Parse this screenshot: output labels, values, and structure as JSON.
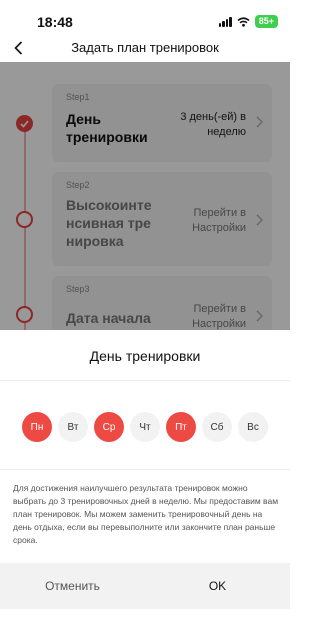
{
  "status_bar": {
    "time": "18:48",
    "battery": "85+"
  },
  "header": {
    "title": "Задать план тренировок"
  },
  "steps": [
    {
      "num": "Step1",
      "title": "День тренировки",
      "value": "3 день(-ей) в неделю",
      "status": "done"
    },
    {
      "num": "Step2",
      "title": "Высокоинтенсивная тренировка",
      "value": "Перейти в Настройки",
      "status": "pending"
    },
    {
      "num": "Step3",
      "title": "Дата начала",
      "value": "Перейти в Настройки",
      "status": "pending"
    }
  ],
  "sheet": {
    "title": "День тренировки",
    "days": [
      {
        "label": "Пн",
        "selected": true
      },
      {
        "label": "Вт",
        "selected": false
      },
      {
        "label": "Ср",
        "selected": true
      },
      {
        "label": "Чт",
        "selected": false
      },
      {
        "label": "Пт",
        "selected": true
      },
      {
        "label": "Сб",
        "selected": false
      },
      {
        "label": "Вс",
        "selected": false
      }
    ],
    "note": "Для достижения наилучшего результата тренировок можно выбрать до 3 тренировочных дней в неделю. Мы предоставим вам план тренировок. Мы можем заменить тренировочный день на день отдыха, если вы перевыполните или закончите план раньше срока.",
    "cancel_label": "Отменить",
    "ok_label": "OK"
  },
  "colors": {
    "accent": "#ee4a44",
    "overlay": "rgba(0,0,0,0.4)",
    "battery": "#3ecf4c"
  }
}
